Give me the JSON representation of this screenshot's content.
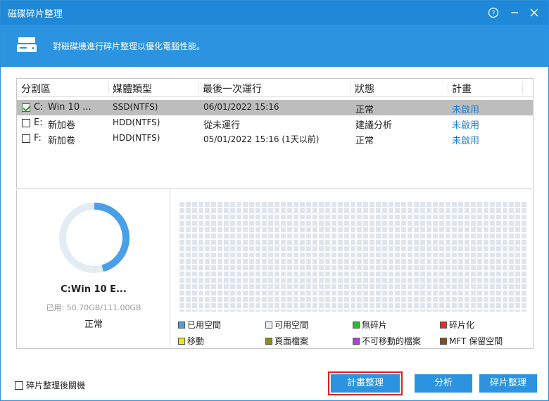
{
  "window": {
    "title": "磁碟碎片整理",
    "help_icon": "help-icon",
    "minimize_icon": "minimize-icon",
    "close_icon": "close-icon"
  },
  "banner": {
    "icon": "disk-icon",
    "description": "對磁碟機進行碎片整理以優化電腦性能。"
  },
  "table": {
    "headers": [
      "分割區",
      "媒體類型",
      "最後一次運行",
      "狀態",
      "計畫"
    ],
    "rows": [
      {
        "checked": true,
        "drive": "C:",
        "name": "Win 10 ...",
        "media": "SSD(NTFS)",
        "last_run": "06/01/2022 15:16",
        "status": "正常",
        "schedule": "未啟用",
        "selected": true
      },
      {
        "checked": false,
        "drive": "E:",
        "name": "新加卷",
        "media": "HDD(NTFS)",
        "last_run": "從未運行",
        "status": "建議分析",
        "schedule": "未啟用",
        "selected": false
      },
      {
        "checked": false,
        "drive": "F:",
        "name": "新加卷",
        "media": "HDD(NTFS)",
        "last_run": "05/01/2022 15:16 (1天以前)",
        "status": "正常",
        "schedule": "未啟用",
        "selected": false
      }
    ]
  },
  "volume": {
    "name": "C:Win 10 E...",
    "used_text": "已用: 50.70GB/111.00GB",
    "used_fraction": 0.457,
    "status": "正常"
  },
  "legend": [
    {
      "label": "已用空間",
      "color": "#4a9fe8"
    },
    {
      "label": "可用空間",
      "color": "#e6ecf4"
    },
    {
      "label": "無碎片",
      "color": "#22c02a"
    },
    {
      "label": "碎片化",
      "color": "#e82a2a"
    },
    {
      "label": "移動",
      "color": "#f2e600"
    },
    {
      "label": "頁面檔案",
      "color": "#8c8c14"
    },
    {
      "label": "不可移動的檔案",
      "color": "#b33ee0"
    },
    {
      "label": "MFT 保留空間",
      "color": "#8b4a14"
    }
  ],
  "footer": {
    "shutdown_label": "碎片整理後關機",
    "schedule_button": "計畫整理",
    "analyze_button": "分析",
    "defrag_button": "碎片整理"
  }
}
